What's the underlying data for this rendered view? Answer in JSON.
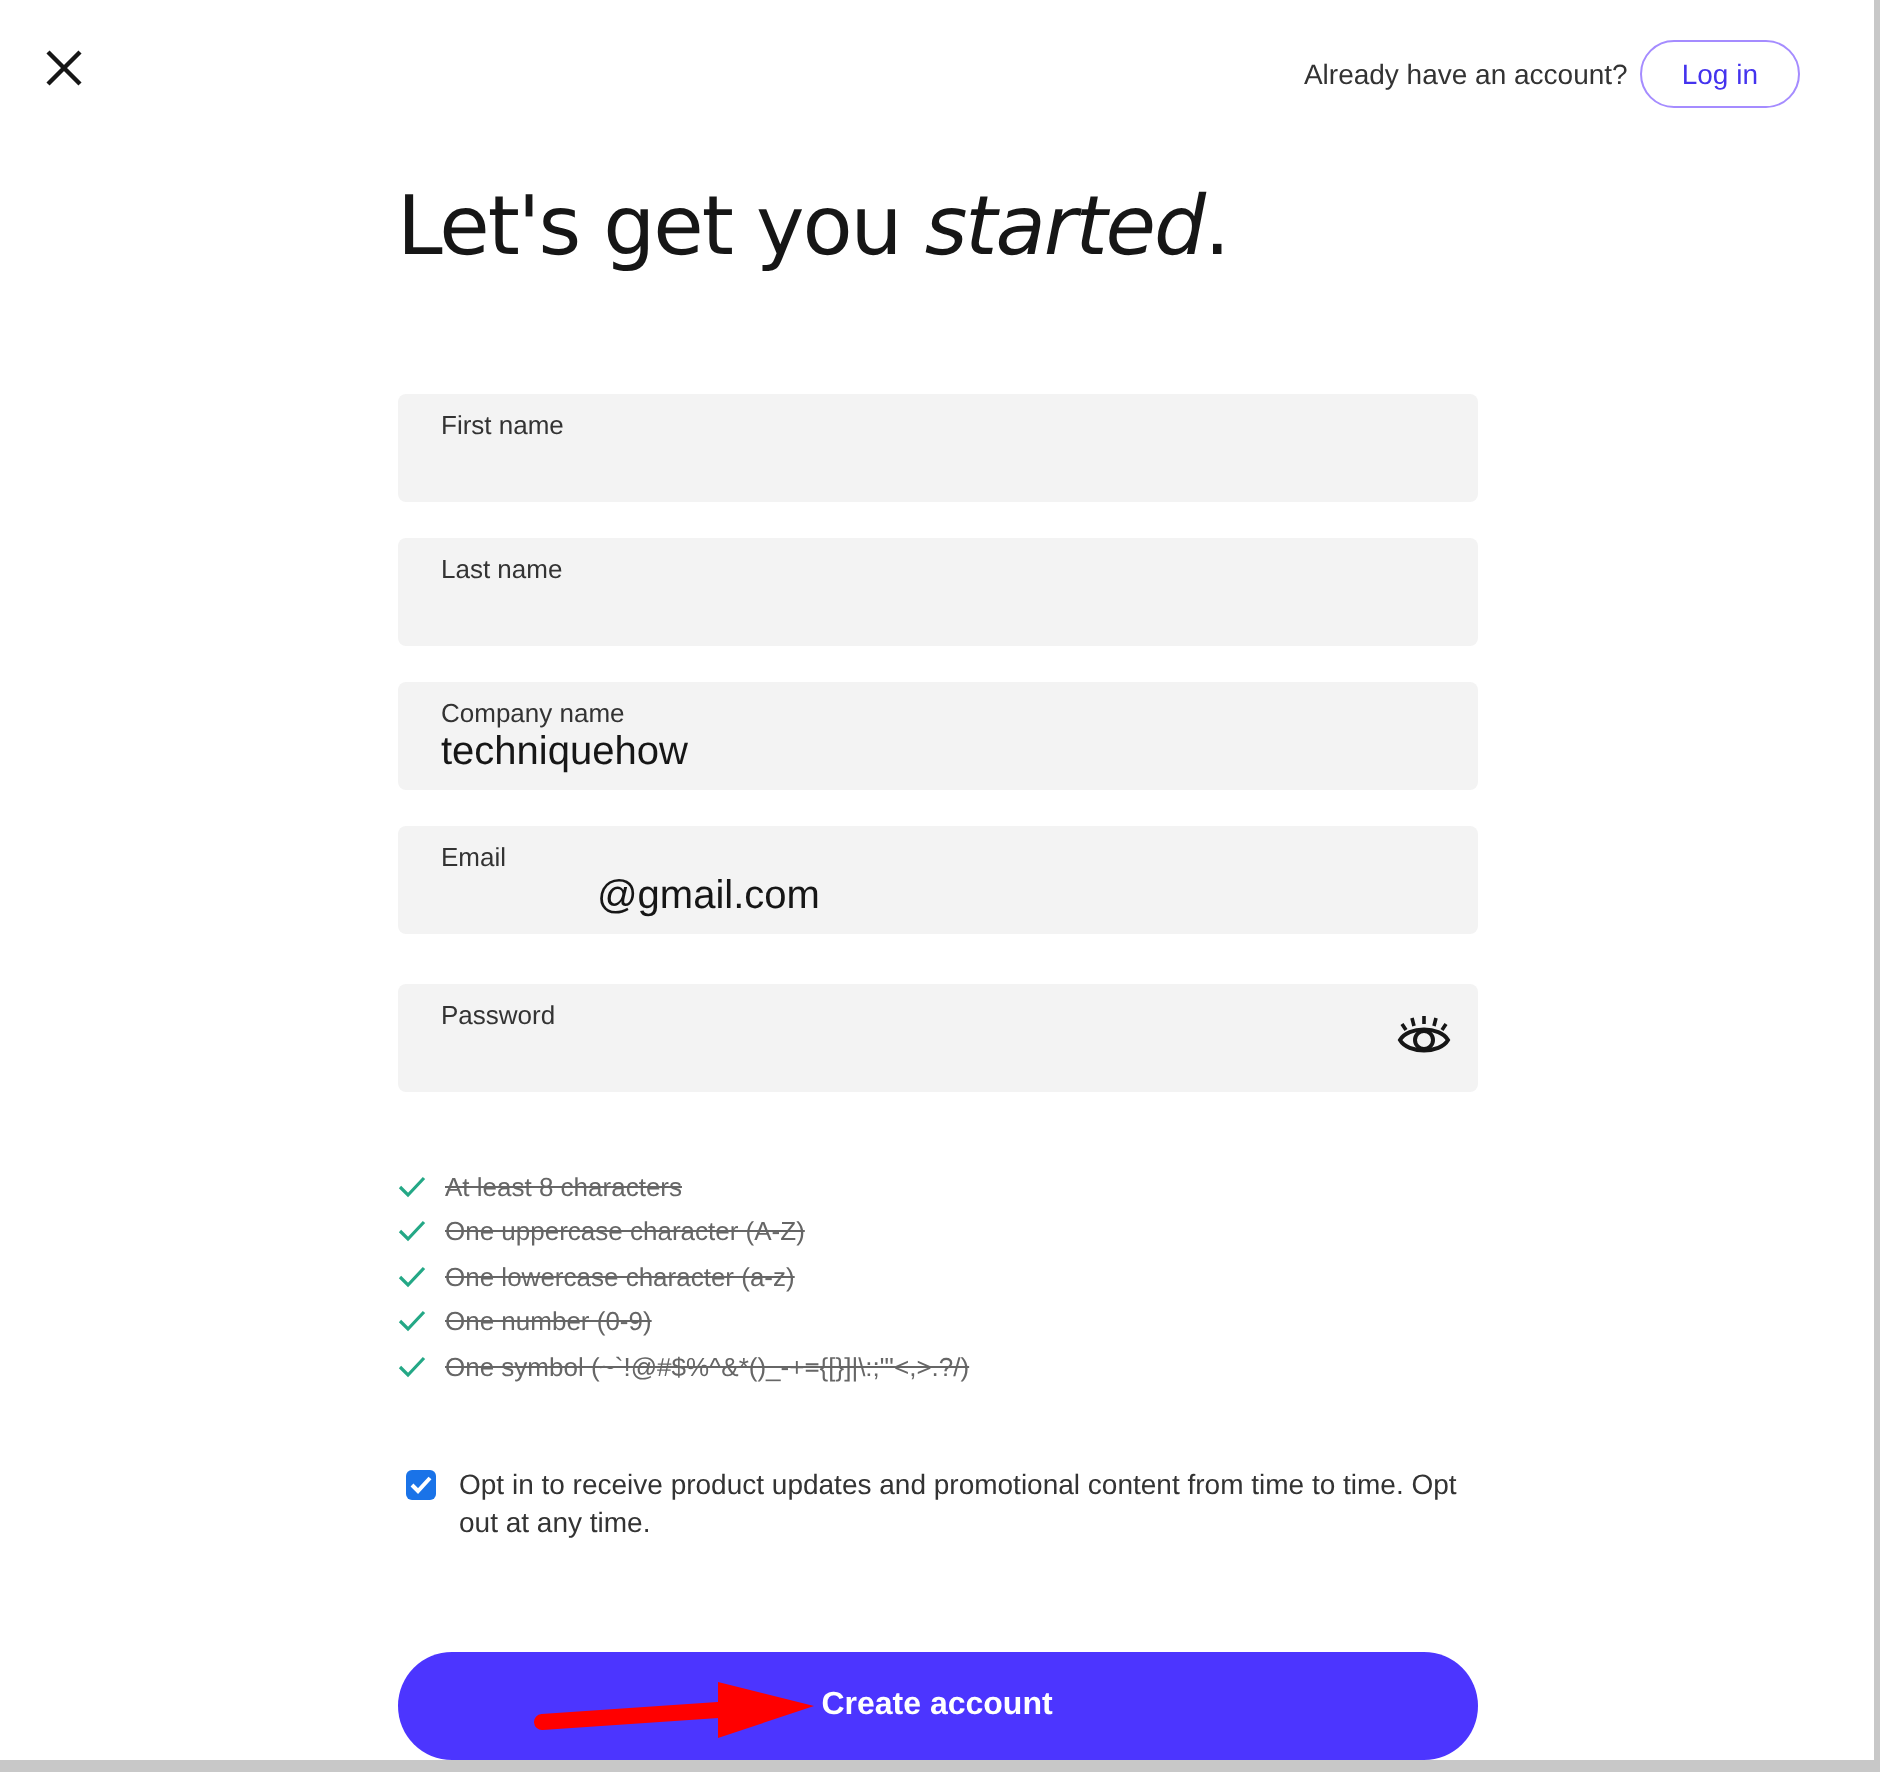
{
  "header": {
    "prompt": "Already have an account?",
    "login_button": "Log in"
  },
  "title": "Let's get you *started*.",
  "fields": [
    {
      "label": "First name",
      "kind": "text"
    },
    {
      "label": "Last name",
      "kind": "text"
    },
    {
      "label": "Company name",
      "value": "techniquehow",
      "kind": "text"
    },
    {
      "label": "Email",
      "value": "@gmail.com",
      "kind": "text"
    },
    {
      "label": "Password",
      "kind": "password"
    }
  ],
  "requirements": [
    {
      "text": "At least 8 characters",
      "met": true
    },
    {
      "text": "One uppercase character (A-Z)",
      "met": true
    },
    {
      "text": "One lowercase character (a-z)",
      "met": true
    },
    {
      "text": "One number (0-9)",
      "met": true
    },
    {
      "text": "One symbol (~`!@#$%^&*()_-+={[}]|\\:;\"'<,>.?/)",
      "met": true
    }
  ],
  "opt_in": {
    "checked": true,
    "text": "Opt in to receive product updates and promotional content from time to time. Opt out at any time."
  },
  "submit_button": "Create account"
}
